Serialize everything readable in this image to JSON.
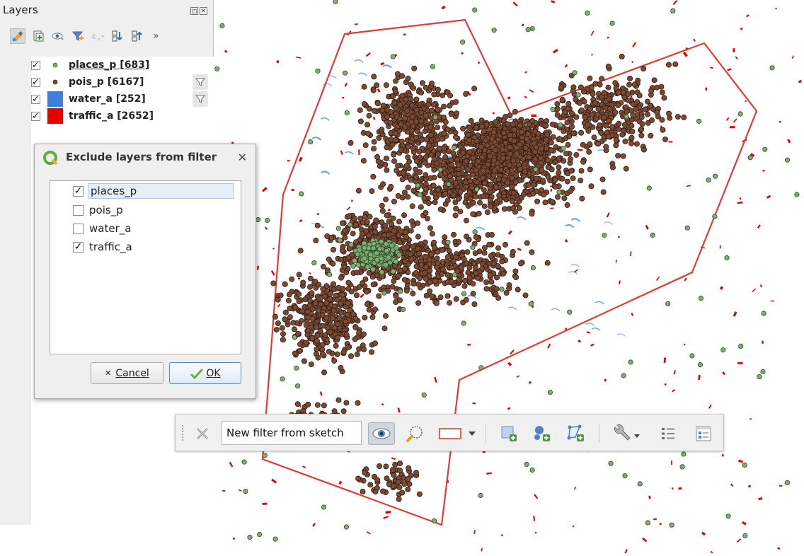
{
  "layers_panel": {
    "title": "Layers",
    "layers": [
      {
        "name": "places_p [683]",
        "checked": true,
        "symbol": "point-green",
        "active": true,
        "filtered": false
      },
      {
        "name": "pois_p [6167]",
        "checked": true,
        "symbol": "point-brown",
        "active": false,
        "filtered": true
      },
      {
        "name": "water_a [252]",
        "checked": true,
        "symbol": "fill-blue",
        "active": false,
        "filtered": true
      },
      {
        "name": "traffic_a [2652]",
        "checked": true,
        "symbol": "fill-red",
        "active": false,
        "filtered": false
      }
    ]
  },
  "exclude_dialog": {
    "title": "Exclude layers from filter",
    "items": [
      {
        "label": "places_p",
        "checked": true,
        "selected": true
      },
      {
        "label": "pois_p",
        "checked": false,
        "selected": false
      },
      {
        "label": "water_a",
        "checked": false,
        "selected": false
      },
      {
        "label": "traffic_a",
        "checked": true,
        "selected": false
      }
    ],
    "cancel_label": "Cancel",
    "ok_label": "OK"
  },
  "sketch_toolbar": {
    "filter_name": "New filter from sketch"
  },
  "colors": {
    "places_point": "#7fae75",
    "pois_point": "#7a4a34",
    "water_fill": "#3f7fdc",
    "traffic_fill": "#e60000",
    "sketch_outline": "#e53935",
    "qgis_green": "#63a93b"
  },
  "check_mark": "✓"
}
